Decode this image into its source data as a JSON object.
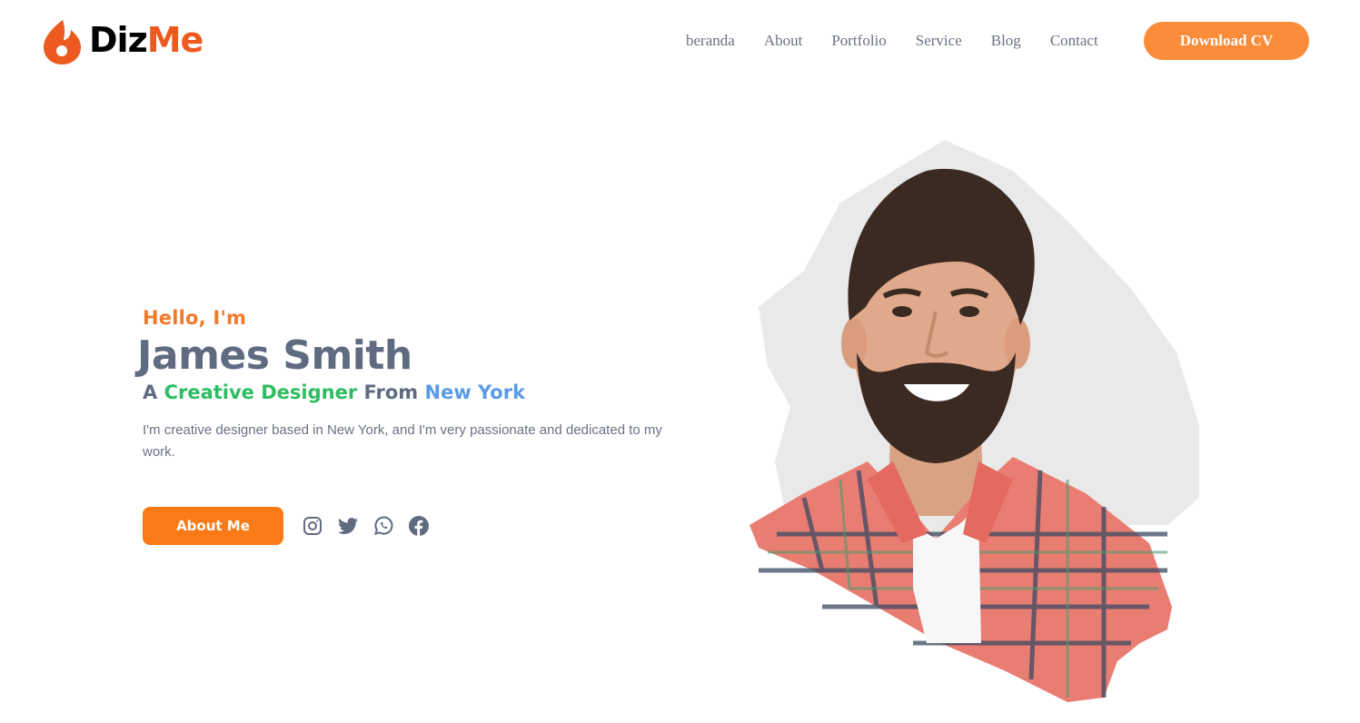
{
  "brand": {
    "part1": "Diz",
    "part2": "Me"
  },
  "nav": {
    "items": [
      {
        "label": "beranda"
      },
      {
        "label": "About"
      },
      {
        "label": "Portfolio"
      },
      {
        "label": "Service"
      },
      {
        "label": "Blog"
      },
      {
        "label": "Contact"
      }
    ],
    "cta_label": "Download CV"
  },
  "hero": {
    "greeting": "Hello, I'm",
    "name": "James Smith",
    "tagline": {
      "prefix": "A ",
      "role": "Creative Designer",
      "middle": " From ",
      "city": "New York"
    },
    "description": "I'm creative designer based in New York, and I'm very passionate and dedicated to my work.",
    "button_label": "About Me",
    "socials": [
      {
        "icon": "instagram-icon"
      },
      {
        "icon": "twitter-icon"
      },
      {
        "icon": "whatsapp-icon"
      },
      {
        "icon": "facebook-icon"
      }
    ]
  },
  "colors": {
    "accent_orange": "#fb7a18",
    "cv_button": "#fb8c3a",
    "green": "#2ebd61",
    "blue": "#5a9ae6",
    "text_slate": "#5f6b81"
  }
}
